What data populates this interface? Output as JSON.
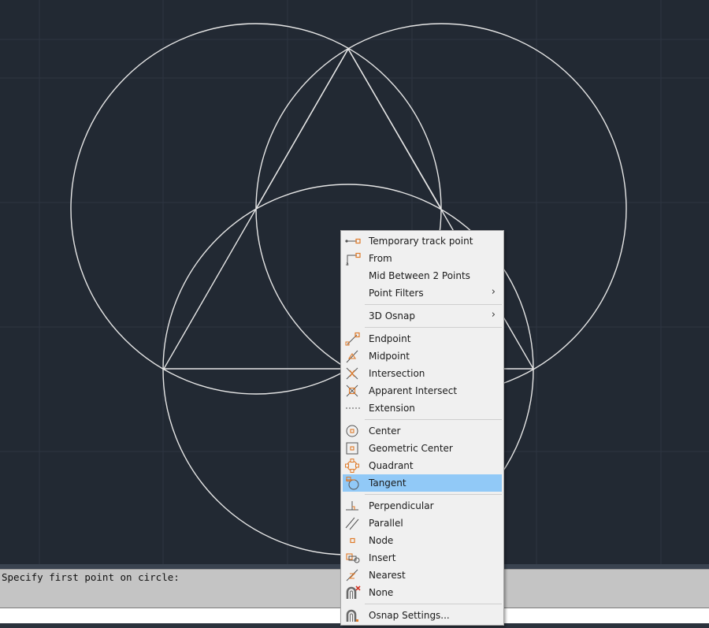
{
  "command_line": {
    "history_text": "Specify first point on circle:",
    "input_value": ""
  },
  "osnap_menu": {
    "items": [
      {
        "label": "Temporary track point",
        "icon": "temporary-track-point-icon"
      },
      {
        "label": "From",
        "icon": "from-icon"
      },
      {
        "label": "Mid Between 2 Points",
        "icon": ""
      },
      {
        "label": "Point Filters",
        "icon": "",
        "submenu": "›"
      },
      {
        "label": "3D Osnap",
        "icon": "",
        "submenu": "›"
      },
      {
        "label": "Endpoint",
        "icon": "endpoint-icon"
      },
      {
        "label": "Midpoint",
        "icon": "midpoint-icon"
      },
      {
        "label": "Intersection",
        "icon": "intersection-icon"
      },
      {
        "label": "Apparent Intersect",
        "icon": "apparent-intersect-icon"
      },
      {
        "label": "Extension",
        "icon": "extension-icon"
      },
      {
        "label": "Center",
        "icon": "center-icon"
      },
      {
        "label": "Geometric Center",
        "icon": "geometric-center-icon"
      },
      {
        "label": "Quadrant",
        "icon": "quadrant-icon"
      },
      {
        "label": "Tangent",
        "icon": "tangent-icon",
        "highlighted": true
      },
      {
        "label": "Perpendicular",
        "icon": "perpendicular-icon"
      },
      {
        "label": "Parallel",
        "icon": "parallel-icon"
      },
      {
        "label": "Node",
        "icon": "node-icon"
      },
      {
        "label": "Insert",
        "icon": "insert-icon"
      },
      {
        "label": "Nearest",
        "icon": "nearest-icon"
      },
      {
        "label": "None",
        "icon": "none-icon"
      },
      {
        "label": "Osnap Settings...",
        "icon": "osnap-settings-icon"
      }
    ]
  },
  "colors": {
    "canvas_background": "#222933",
    "grid": "#2d3541",
    "geometry": "#e6e6e6",
    "menu_highlight": "#91c9f7",
    "icon_accent": "#e07b2a"
  }
}
